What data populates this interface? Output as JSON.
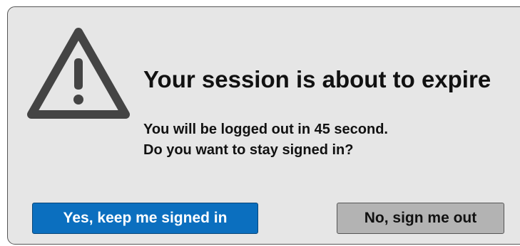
{
  "dialog": {
    "icon": "warning-triangle-icon",
    "title": "Your session is about to expire",
    "message_line1": "You will be logged out in 45 second.",
    "message_line2": "Do you want to stay signed in?",
    "countdown_seconds": 45
  },
  "buttons": {
    "stay_label": "Yes, keep me signed in",
    "logout_label": "No, sign me out"
  },
  "colors": {
    "dialog_background": "#e6e6e6",
    "primary_button": "#0b6fbf",
    "secondary_button": "#b3b3b3",
    "icon": "#444444"
  }
}
